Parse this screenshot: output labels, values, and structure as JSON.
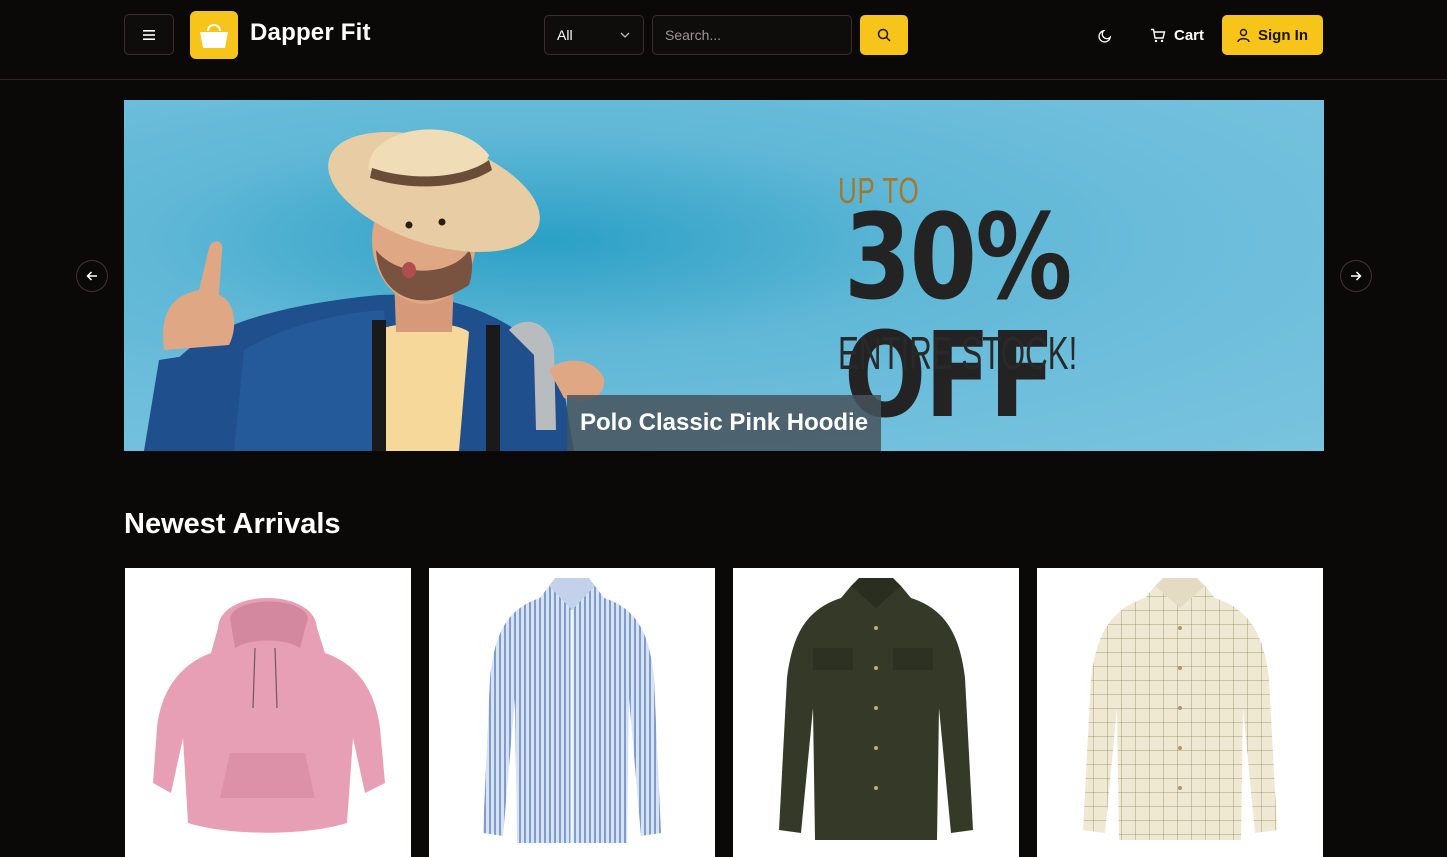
{
  "header": {
    "brand": "Dapper Fit",
    "category_select": {
      "value": "All"
    },
    "search": {
      "placeholder": "Search..."
    },
    "cart_label": "Cart",
    "signin_label": "Sign In"
  },
  "carousel": {
    "caption": "Polo Classic Pink Hoodie",
    "promo": {
      "up_to": "UP TO",
      "headline": "30% OFF",
      "subline": "ENTIRE STOCK!"
    }
  },
  "section": {
    "title": "Newest Arrivals",
    "products": [
      {
        "image": "pink-hoodie",
        "color": "#e79fb6"
      },
      {
        "image": "blue-striped-shirt",
        "color": "#a9bfe0"
      },
      {
        "image": "olive-green-shirt",
        "color": "#353a28"
      },
      {
        "image": "cream-check-shirt",
        "color": "#efe9d4"
      }
    ]
  },
  "colors": {
    "accent": "#f7c51a",
    "background": "#0b0908"
  },
  "icons": [
    "menu-icon",
    "shopping-bag-icon",
    "chevron-down-icon",
    "search-icon",
    "moon-icon",
    "cart-icon",
    "user-icon",
    "arrow-left-icon",
    "arrow-right-icon"
  ]
}
